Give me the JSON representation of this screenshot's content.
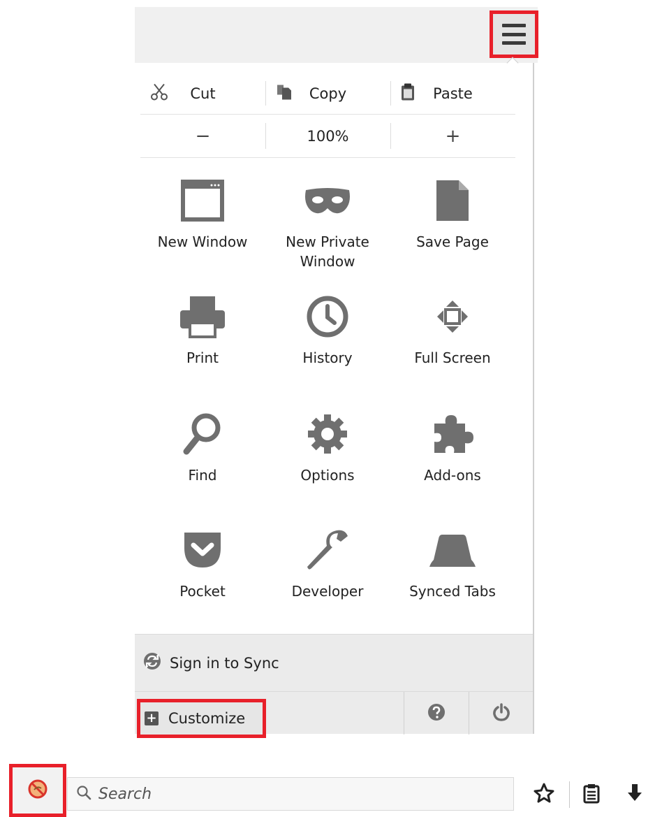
{
  "menu": {
    "button_icon": "hamburger-menu-icon",
    "edit_row": [
      {
        "label": "Cut",
        "icon": "scissors-icon"
      },
      {
        "label": "Copy",
        "icon": "copy-icon"
      },
      {
        "label": "Paste",
        "icon": "clipboard-icon"
      }
    ],
    "zoom_row": {
      "decrease": "−",
      "level": "100%",
      "increase": "+"
    },
    "items": [
      {
        "label": "New Window",
        "icon": "window-icon"
      },
      {
        "label": "New Private\nWindow",
        "icon": "mask-icon"
      },
      {
        "label": "Save Page",
        "icon": "page-icon"
      },
      {
        "label": "Print",
        "icon": "printer-icon"
      },
      {
        "label": "History",
        "icon": "clock-icon"
      },
      {
        "label": "Full Screen",
        "icon": "fullscreen-icon"
      },
      {
        "label": "Find",
        "icon": "magnifier-icon"
      },
      {
        "label": "Options",
        "icon": "gear-icon"
      },
      {
        "label": "Add-ons",
        "icon": "puzzle-icon"
      },
      {
        "label": "Pocket",
        "icon": "pocket-icon"
      },
      {
        "label": "Developer",
        "icon": "wrench-icon"
      },
      {
        "label": "Synced Tabs",
        "icon": "synced-tabs-icon"
      }
    ],
    "sync_label": "Sign in to Sync",
    "customize_label": "Customize"
  },
  "searchbar": {
    "placeholder": "Search"
  },
  "colors": {
    "highlight": "#e8202a",
    "icon": "#6f6f6f"
  }
}
